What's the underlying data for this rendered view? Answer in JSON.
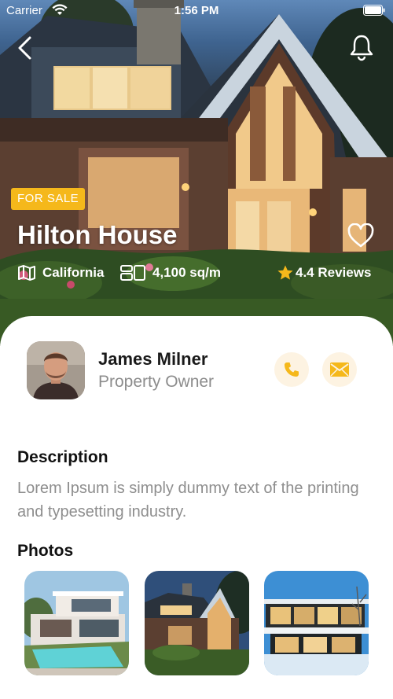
{
  "status_bar": {
    "carrier": "Carrier",
    "time": "1:56 PM"
  },
  "nav": {
    "back_icon": "chevron-left-icon",
    "notification_icon": "bell-icon"
  },
  "property": {
    "badge": "FOR SALE",
    "title": "Hilton House",
    "location": "California",
    "area": "4,100 sq/m",
    "reviews": "4.4 Reviews",
    "favorite_icon": "heart-outline-icon"
  },
  "owner": {
    "name": "James Milner",
    "role": "Property Owner",
    "call_icon": "phone-icon",
    "message_icon": "mail-icon"
  },
  "description": {
    "title": "Description",
    "text": "Lorem Ipsum is simply dummy text of the printing and typesetting industry."
  },
  "photos": {
    "title": "Photos",
    "items": [
      "modern-villa-pool-photo",
      "evening-house-photo",
      "glass-house-night-photo"
    ]
  },
  "colors": {
    "accent": "#f5b81b",
    "soft_accent_bg": "#fdf3e2",
    "muted_text": "#8e8e8e"
  }
}
